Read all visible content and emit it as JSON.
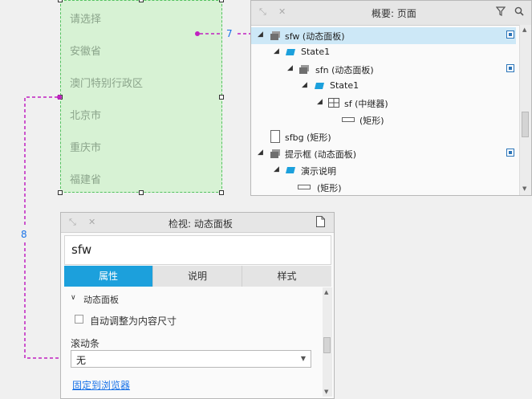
{
  "list_widget": {
    "items": [
      "请选择",
      "安徽省",
      "澳门特别行政区",
      "北京市",
      "重庆市",
      "福建省"
    ]
  },
  "connectors": [
    {
      "label": "7"
    },
    {
      "label": "8"
    }
  ],
  "outline_panel": {
    "title": "概要: 页面",
    "rows": [
      {
        "label": "sfw (动态面板)",
        "indent": 0,
        "icon": "dynamic-panel-icon",
        "checkbox": true,
        "selected": true
      },
      {
        "label": "State1",
        "indent": 1,
        "icon": "state-icon",
        "checkbox": false
      },
      {
        "label": "sfn (动态面板)",
        "indent": 2,
        "icon": "dynamic-panel-icon",
        "checkbox": true
      },
      {
        "label": "State1",
        "indent": 3,
        "icon": "state-icon",
        "checkbox": false
      },
      {
        "label": "sf (中继器)",
        "indent": 4,
        "icon": "repeater-icon",
        "checkbox": false
      },
      {
        "label": "(矩形)",
        "indent": 5,
        "icon": "rectangle-icon",
        "checkbox": false
      },
      {
        "label": "sfbg (矩形)",
        "indent": 0,
        "icon": "rectangle-icon",
        "checkbox": false
      },
      {
        "label": "提示框 (动态面板)",
        "indent": 0,
        "icon": "dynamic-panel-icon",
        "checkbox": true
      },
      {
        "label": "演示说明",
        "indent": 1,
        "icon": "state-icon",
        "checkbox": false
      },
      {
        "label": "(矩形)",
        "indent": 2,
        "icon": "rectangle-icon",
        "checkbox": false
      }
    ]
  },
  "inspector_panel": {
    "title": "检视: 动态面板",
    "name_value": "sfw",
    "tabs": [
      "属性",
      "说明",
      "样式"
    ],
    "active_tab": "属性",
    "section_title": "动态面板",
    "auto_fit_label": "自动调整为内容尺寸",
    "scrollbar_label": "滚动条",
    "scrollbar_value": "无",
    "pin_link": "固定到浏览器"
  },
  "colors": {
    "accent": "#1ca0dc",
    "connector": "#c020c0",
    "selection_green": "#d7f2d4",
    "tree_selection": "#cde8f7"
  }
}
